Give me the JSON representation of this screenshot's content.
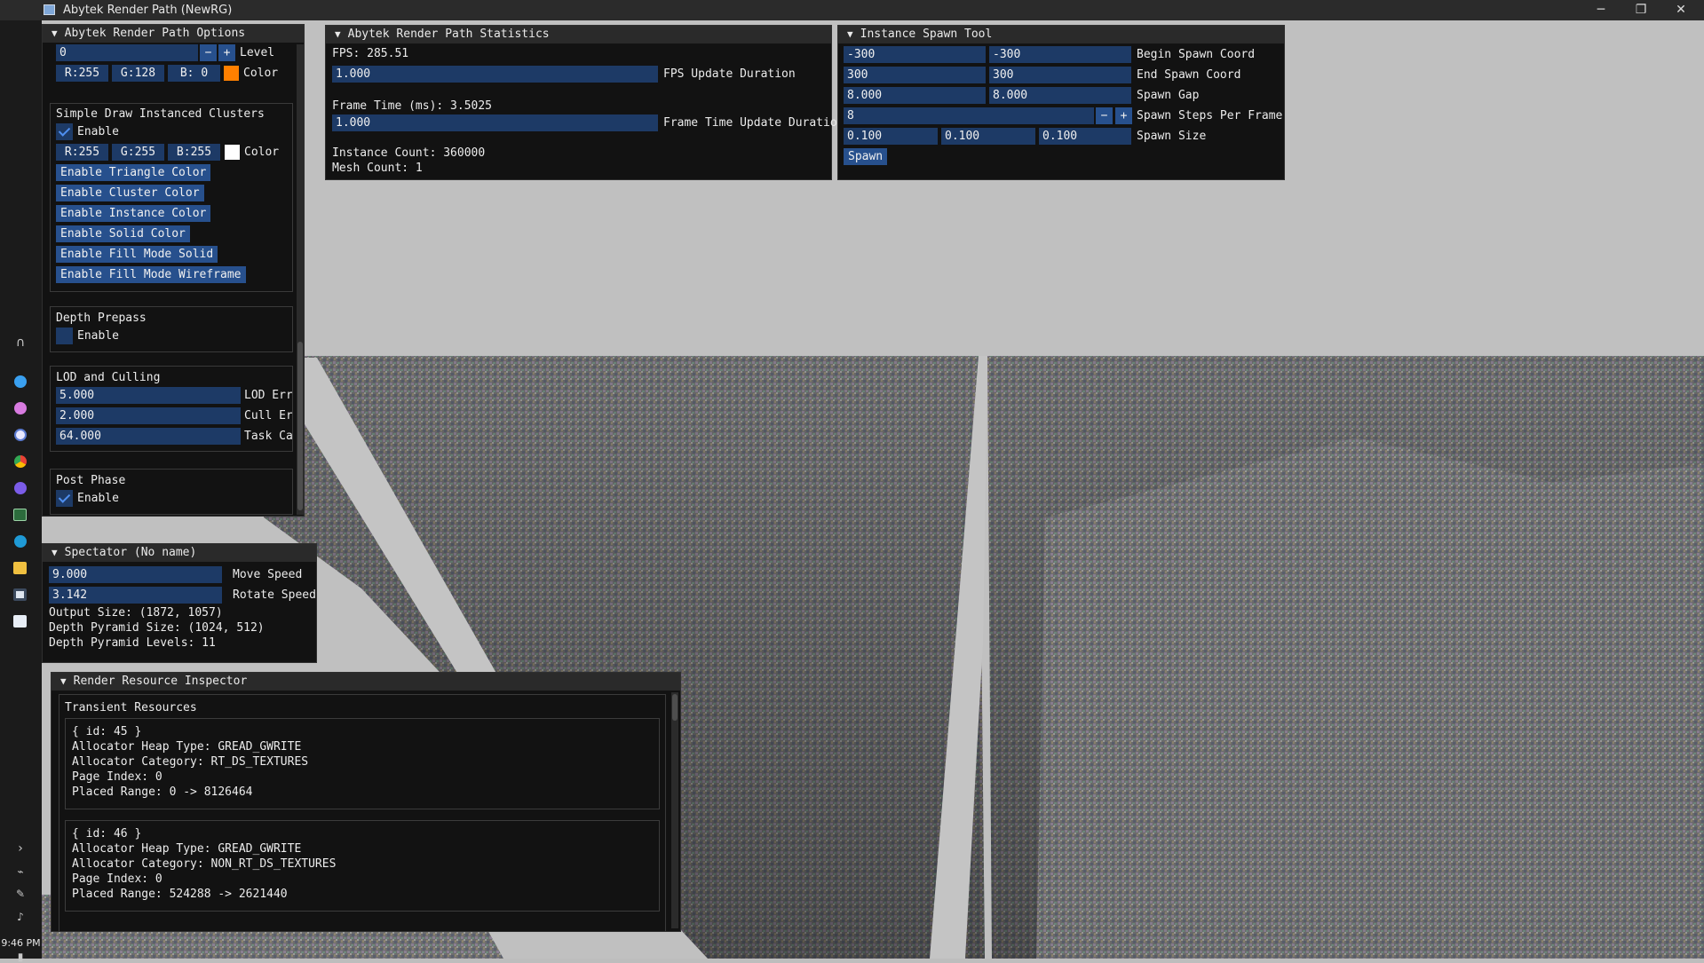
{
  "window": {
    "title": "Abytek Render Path (NewRG)",
    "minimize": "─",
    "restore": "❐",
    "close": "✕"
  },
  "taskbar": {
    "time": "9:46 PM",
    "chevron": "›"
  },
  "options_panel": {
    "title": "Abytek Render Path Options",
    "level_value": "0",
    "level_label": "Level",
    "minus": "−",
    "plus": "+",
    "color_r": "R:255",
    "color_g": "G:128",
    "color_b": "B: 0",
    "color_label": "Color",
    "color_swatch": "#ff8000",
    "clusters": {
      "title": "Simple Draw Instanced Clusters",
      "enable_label": "Enable",
      "enabled": true,
      "color_r": "R:255",
      "color_g": "G:255",
      "color_b": "B:255",
      "color_label": "Color",
      "color_swatch": "#ffffff",
      "buttons": [
        "Enable Triangle Color",
        "Enable Cluster Color",
        "Enable Instance Color",
        "Enable Solid Color",
        "Enable Fill Mode Solid",
        "Enable Fill Mode Wireframe"
      ]
    },
    "depth_prepass": {
      "title": "Depth Prepass",
      "enable_label": "Enable",
      "enabled": false
    },
    "lod": {
      "title": "LOD and Culling",
      "lod_error": "5.000",
      "lod_error_label": "LOD Erro",
      "cull_error": "2.000",
      "cull_error_label": "Cull Err",
      "task_cap": "64.000",
      "task_cap_label": "Task Cap"
    },
    "post_phase": {
      "title": "Post Phase",
      "enable_label": "Enable",
      "enabled": true
    }
  },
  "spectator": {
    "title": "Spectator (No name)",
    "move_speed": "9.000",
    "move_speed_label": "Move Speed",
    "rotate_speed": "3.142",
    "rotate_speed_label": "Rotate Speed",
    "output_size": "Output Size: (1872, 1057)",
    "pyramid_size": "Depth Pyramid Size: (1024, 512)",
    "pyramid_levels": "Depth Pyramid Levels: 11"
  },
  "statistics": {
    "title": "Abytek Render Path Statistics",
    "fps": "FPS: 285.51",
    "fps_update_value": "1.000",
    "fps_update_label": "FPS Update Duration",
    "frame_time": "Frame Time (ms): 3.5025",
    "frame_update_value": "1.000",
    "frame_update_label": "Frame Time Update Duration",
    "instance_count": "Instance Count: 360000",
    "mesh_count": "Mesh Count: 1"
  },
  "spawn_tool": {
    "title": "Instance Spawn Tool",
    "begin_x": "-300",
    "begin_y": "-300",
    "begin_label": "Begin Spawn Coord",
    "end_x": "300",
    "end_y": "300",
    "end_label": "End Spawn Coord",
    "gap_x": "8.000",
    "gap_y": "8.000",
    "gap_label": "Spawn Gap",
    "steps": "8",
    "steps_label": "Spawn Steps Per Frame",
    "size_x": "0.100",
    "size_y": "0.100",
    "size_z": "0.100",
    "size_label": "Spawn Size",
    "spawn_button": "Spawn"
  },
  "inspector": {
    "title": "Render Resource Inspector",
    "section": "Transient Resources",
    "resources": [
      {
        "id": "{ id: 45 }",
        "heap": "Allocator Heap Type: GREAD_GWRITE",
        "category": "Allocator Category: RT_DS_TEXTURES",
        "page": "Page Index: 0",
        "range": "Placed Range: 0 -> 8126464"
      },
      {
        "id": "{ id: 46 }",
        "heap": "Allocator Heap Type: GREAD_GWRITE",
        "category": "Allocator Category: NON_RT_DS_TEXTURES",
        "page": "Page Index: 0",
        "range": "Placed Range: 524288 -> 2621440"
      }
    ]
  }
}
